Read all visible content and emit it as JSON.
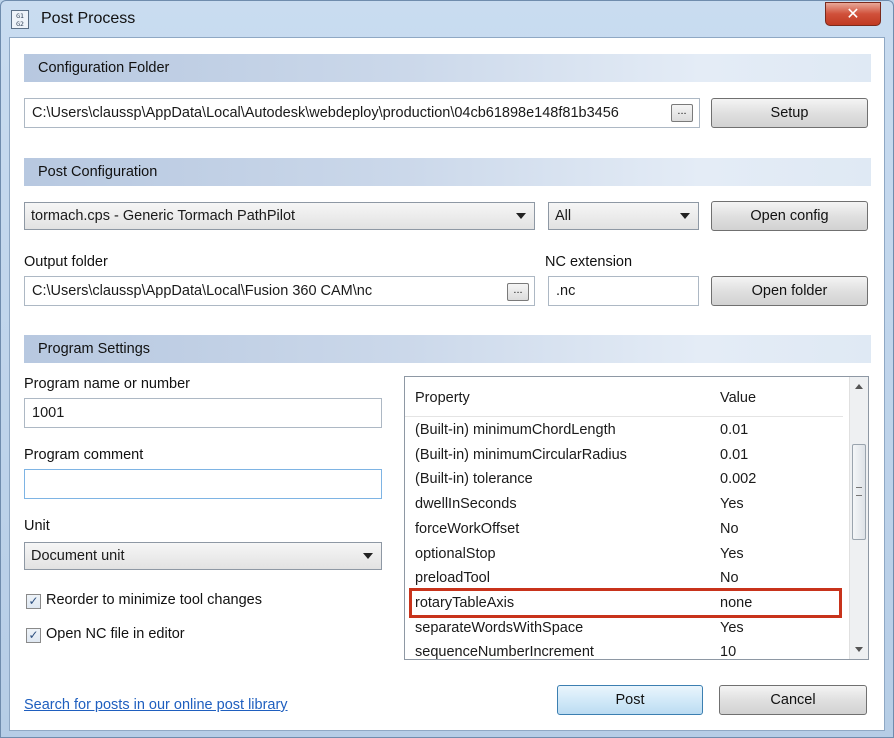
{
  "window": {
    "title": "Post Process",
    "icon_text": "G1\nG2",
    "close_label": "✕"
  },
  "config_folder": {
    "header": "Configuration Folder",
    "path": "C:\\Users\\claussp\\AppData\\Local\\Autodesk\\webdeploy\\production\\04cb61898e148f81b3456",
    "browse_label": "...",
    "setup_label": "Setup"
  },
  "post_config": {
    "header": "Post Configuration",
    "post_selected": "tormach.cps - Generic Tormach PathPilot",
    "filter_selected": "All",
    "open_config_label": "Open config",
    "output_folder_label": "Output folder",
    "output_folder_path": "C:\\Users\\claussp\\AppData\\Local\\Fusion 360 CAM\\nc",
    "output_browse_label": "...",
    "nc_extension_label": "NC extension",
    "nc_extension_value": ".nc",
    "open_folder_label": "Open folder"
  },
  "program_settings": {
    "header": "Program Settings",
    "program_name_label": "Program name or number",
    "program_name_value": "1001",
    "program_comment_label": "Program comment",
    "program_comment_value": "",
    "unit_label": "Unit",
    "unit_selected": "Document unit",
    "reorder_label": "Reorder to minimize tool changes",
    "reorder_checked": true,
    "open_nc_label": "Open NC file in editor",
    "open_nc_checked": true,
    "check_glyph": "✓"
  },
  "properties": {
    "col_property": "Property",
    "col_value": "Value",
    "rows": [
      {
        "name": "(Built-in) minimumChordLength",
        "value": "0.01"
      },
      {
        "name": "(Built-in) minimumCircularRadius",
        "value": "0.01"
      },
      {
        "name": "(Built-in) tolerance",
        "value": "0.002"
      },
      {
        "name": "dwellInSeconds",
        "value": "Yes"
      },
      {
        "name": "forceWorkOffset",
        "value": "No"
      },
      {
        "name": "optionalStop",
        "value": "Yes"
      },
      {
        "name": "preloadTool",
        "value": "No"
      },
      {
        "name": "rotaryTableAxis",
        "value": "none"
      },
      {
        "name": "separateWordsWithSpace",
        "value": "Yes"
      },
      {
        "name": "sequenceNumberIncrement",
        "value": "10"
      }
    ],
    "highlighted_row": "rotaryTableAxis",
    "highlight_color": "#c8331b"
  },
  "footer": {
    "library_link": "Search for posts in our online post library",
    "post_label": "Post",
    "cancel_label": "Cancel"
  }
}
